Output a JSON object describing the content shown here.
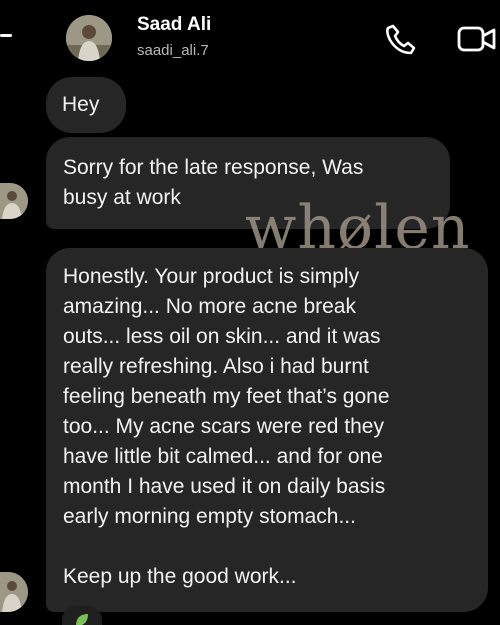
{
  "header": {
    "name": "Saad Ali",
    "username": "saadi_ali.7",
    "icons": [
      "back-icon",
      "phone-icon",
      "video-call-icon"
    ]
  },
  "messages": [
    {
      "text": "Hey"
    },
    {
      "text": "Sorry for the late response, Was busy at work",
      "lines": [
        "Sorry for the late response, Was",
        "busy at work"
      ]
    },
    {
      "lines": [
        "Honestly. Your product is simply",
        "amazing... No more acne break",
        "outs... less oil on skin... and it was",
        "really refreshing. Also i had burnt",
        "feeling beneath my feet that’s gone",
        "too... My acne scars were red they",
        "have little bit calmed... and for one",
        "month I have used it on daily basis",
        "early morning empty stomach...",
        "",
        "Keep up the good work..."
      ]
    }
  ],
  "watermark": "whølen",
  "colors": {
    "background": "#000000",
    "bubble": "#262626",
    "text": "#f2f2f2",
    "watermark": "#9b9283",
    "reaction": "#7bbf5a"
  }
}
